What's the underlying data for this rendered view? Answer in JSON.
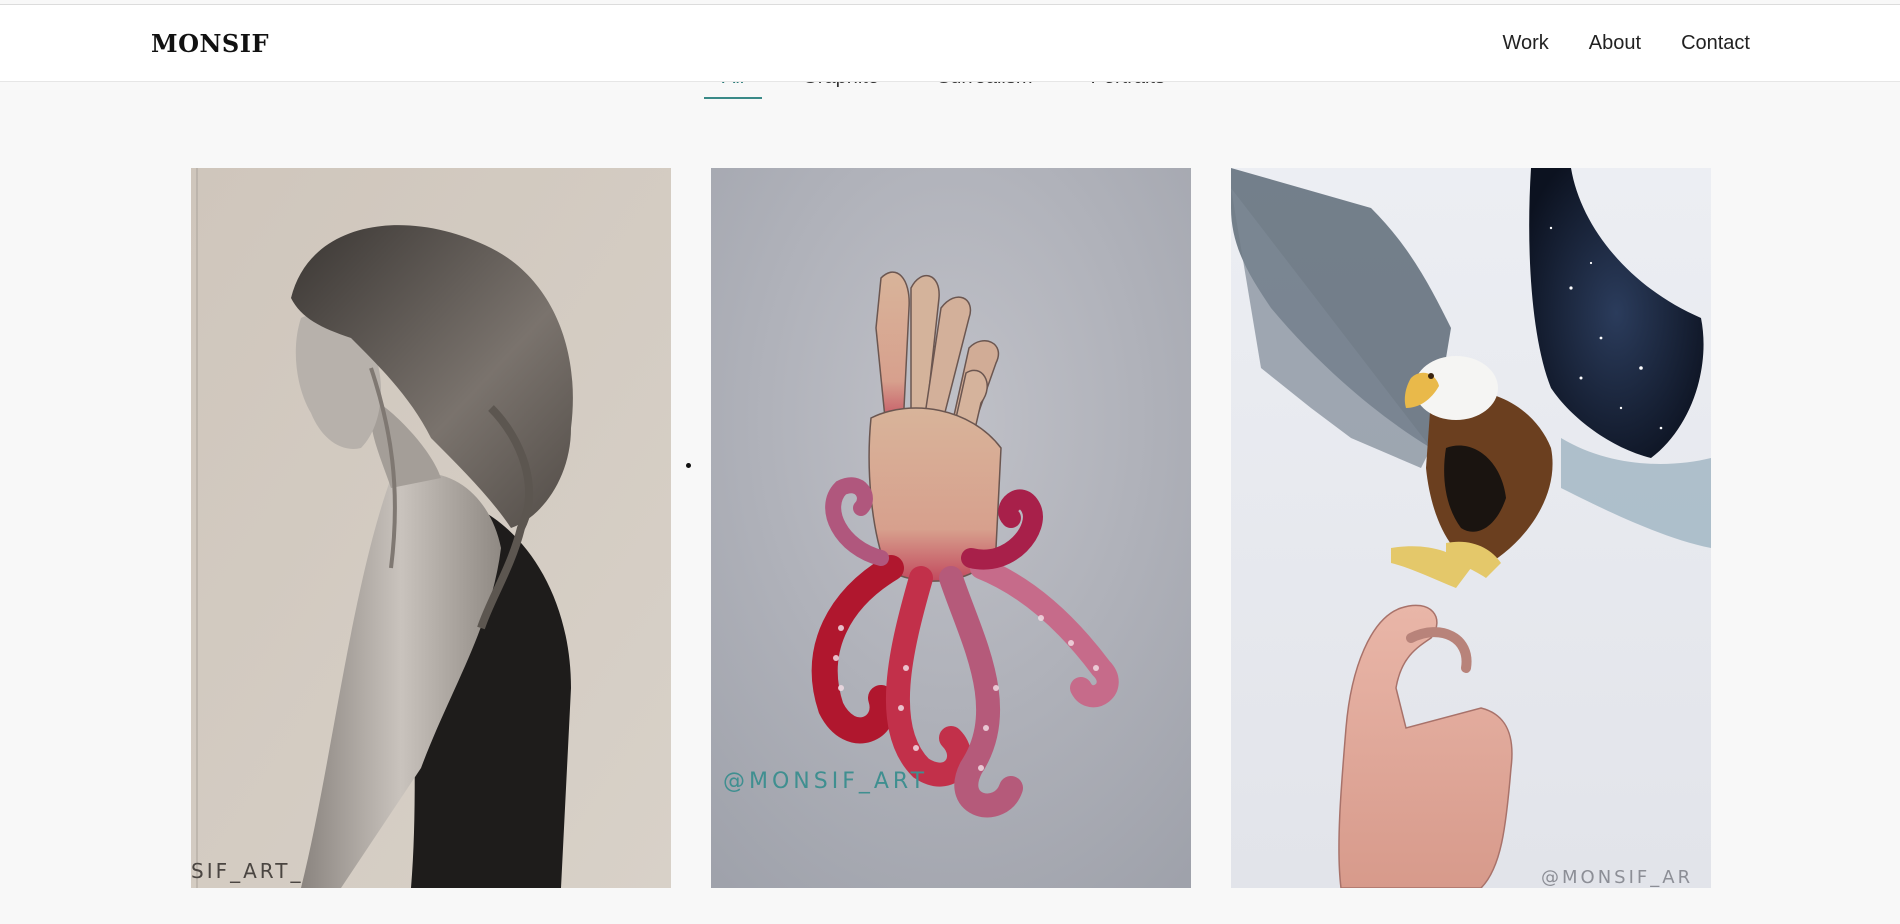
{
  "brand": {
    "name": "MONSIF"
  },
  "nav": {
    "items": [
      "Work",
      "About",
      "Contact"
    ]
  },
  "filters": {
    "items": [
      "All",
      "Graphite",
      "Surrealism",
      "Portraits"
    ],
    "active": "All"
  },
  "gallery": {
    "items": [
      {
        "subject": "woman-graphite-portrait",
        "watermark": "SIF_ART_"
      },
      {
        "subject": "hand-octopus-surreal",
        "watermark": "@MONSIF_ART"
      },
      {
        "subject": "eagle-and-hand",
        "watermark": "@MONSIF_AR"
      }
    ]
  },
  "colors": {
    "accent": "#3a8a88",
    "header_bg": "#ffffff",
    "page_bg": "#f8f8f8"
  }
}
